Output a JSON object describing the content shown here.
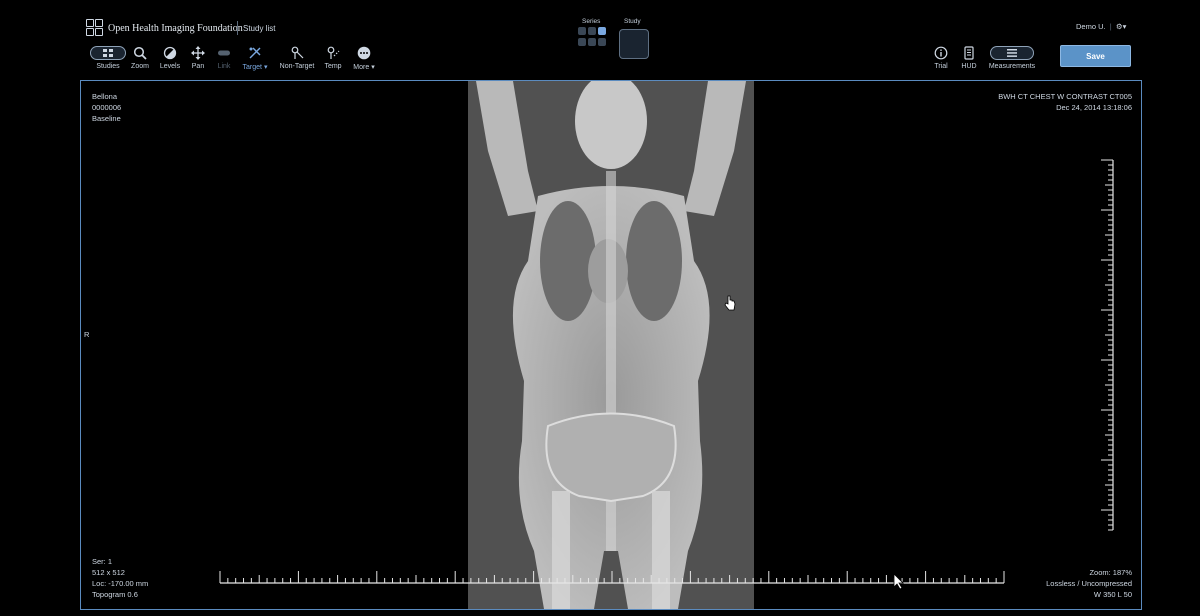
{
  "header": {
    "app_title": "Open Health Imaging Foundation",
    "study_list_link": "Study list"
  },
  "toolbar": {
    "tools": [
      {
        "label": "Studies",
        "icon": "studies-icon"
      },
      {
        "label": "Zoom",
        "icon": "zoom-icon"
      },
      {
        "label": "Levels",
        "icon": "levels-icon"
      },
      {
        "label": "Pan",
        "icon": "pan-icon"
      },
      {
        "label": "Link",
        "icon": "link-icon"
      },
      {
        "label": "Target",
        "icon": "target-icon"
      },
      {
        "label": "Non-Target",
        "icon": "non-target-icon"
      },
      {
        "label": "Temp",
        "icon": "temp-icon"
      },
      {
        "label": "More",
        "icon": "more-icon"
      }
    ],
    "right_tools": [
      {
        "label": "Trial",
        "icon": "info-icon"
      },
      {
        "label": "HUD",
        "icon": "hud-icon"
      },
      {
        "label": "Measurements",
        "icon": "measurements-icon"
      }
    ]
  },
  "layout": {
    "series_label": "Series",
    "study_label": "Study"
  },
  "user": {
    "name": "Demo U."
  },
  "save_label": "Save",
  "viewport": {
    "patient_name": "Bellona",
    "patient_id": "0000006",
    "timepoint": "Baseline",
    "study_description": "BWH CT CHEST W CONTRAST CT005",
    "study_date": "Dec 24, 2014 13:18:06",
    "orientation_marker": "R",
    "series": "Ser: 1",
    "dimensions": "512 x 512",
    "location": "Loc: -170.00 mm",
    "image_type": "Topogram 0.6",
    "zoom": "Zoom: 187%",
    "compression": "Lossless / Uncompressed",
    "window_level": "W 350 L 50"
  },
  "colors": {
    "accent": "#5b93c8",
    "viewport_border": "#5b8bbf",
    "background": "#000000"
  }
}
